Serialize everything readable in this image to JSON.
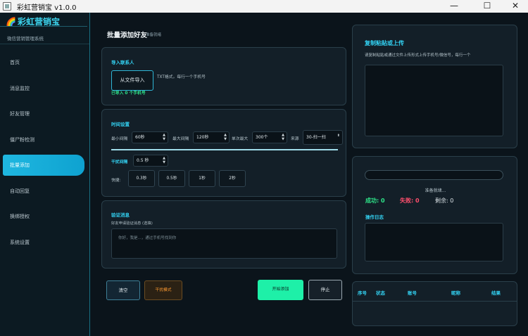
{
  "window": {
    "title": "彩虹营销宝 v1.0.0",
    "min": "—",
    "max": "☐",
    "close": "✕"
  },
  "sidebar": {
    "brand": "彩虹营销宝",
    "subtitle": "微信营销管理系统",
    "items": [
      {
        "label": "首页"
      },
      {
        "label": "消息监控"
      },
      {
        "label": "好友管理"
      },
      {
        "label": "僵尸粉检测"
      },
      {
        "label": "批量添加",
        "active": true
      },
      {
        "label": "自动回复"
      },
      {
        "label": "换绑授权"
      },
      {
        "label": "系统设置"
      }
    ]
  },
  "main": {
    "title": "批量添加好友",
    "status": "准备就绪"
  },
  "import": {
    "header": "导入联系人",
    "button": "从文件导入",
    "hint": "TXT格式，每行一个手机号",
    "count": "已导入 0 个手机号"
  },
  "timing": {
    "header": "时间设置",
    "min_label": "最小间隔",
    "min_value": "60秒",
    "max_label": "最大间隔",
    "max_value": "120秒",
    "batch_label": "单次最大",
    "batch_value": "300个",
    "source_label": "来源",
    "source_value": "30-扫一扫",
    "interference_label": "干扰间隔",
    "interference_value": "0.5 秒",
    "quick_label": "快捷:",
    "quick": [
      "0.3秒",
      "0.5秒",
      "1秒",
      "2秒"
    ]
  },
  "verify": {
    "header": "验证消息",
    "label": "好友申请验证消息 (选填)",
    "placeholder": "你好，我是...，通过手机号找到你"
  },
  "actions": {
    "clear": "清空",
    "interfere": "干扰模式",
    "start": "开始添加",
    "stop": "停止"
  },
  "upload": {
    "header": "复制粘贴或上传",
    "hint": "请复制粘贴或通过文件上传形式上传手机号/微信号，每行一个"
  },
  "progress": {
    "status": "准备就绪...",
    "success_label": "成功:",
    "success": "0",
    "fail_label": "失败:",
    "fail": "0",
    "remain_label": "剩余:",
    "remain": "0",
    "log_header": "操作日志"
  },
  "table": {
    "columns": [
      "序号",
      "状态",
      "账号",
      "昵称",
      "结果"
    ]
  },
  "colors": {
    "accent": "#33d3f4",
    "success": "#2ee68a",
    "fail": "#ff4f6d",
    "start": "#1ef0a8",
    "interfere": "#ff9a30"
  }
}
